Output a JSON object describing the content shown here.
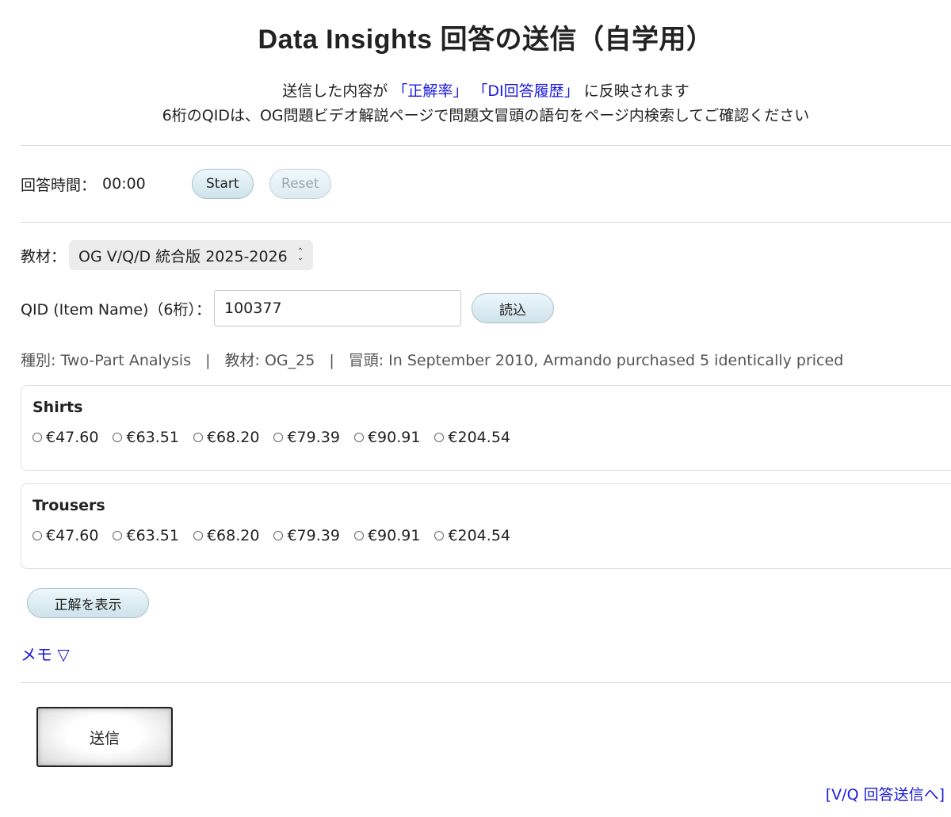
{
  "title": "Data Insights 回答の送信（自学用）",
  "notice": {
    "line1_prefix": "送信した内容が",
    "link1": "「正解率」",
    "link2": "「DI回答履歴」",
    "line1_suffix": "に反映されます",
    "line2": "6桁のQIDは、OG問題ビデオ解説ページで問題文冒頭の語句をページ内検索してご確認ください"
  },
  "timer": {
    "label": "回答時間：",
    "value": "00:00",
    "start_label": "Start",
    "reset_label": "Reset"
  },
  "material": {
    "label": "教材：",
    "selected": "OG V/Q/D 統合版 2025-2026"
  },
  "qid": {
    "label": "QID (Item Name)（6桁）：",
    "value": "100377",
    "load_label": "読込"
  },
  "meta": {
    "type": "種別: Two-Part Analysis",
    "material": "教材: OG_25",
    "opening": "冒頭: In September 2010, Armando purchased 5 identically priced",
    "separator": "|"
  },
  "columns": [
    {
      "label": "Shirts",
      "options": [
        "€47.60",
        "€63.51",
        "€68.20",
        "€79.39",
        "€90.91",
        "€204.54"
      ]
    },
    {
      "label": "Trousers",
      "options": [
        "€47.60",
        "€63.51",
        "€68.20",
        "€79.39",
        "€90.91",
        "€204.54"
      ]
    }
  ],
  "show_answer_label": "正解を表示",
  "memo_label": "メモ ▽",
  "submit_label": "送信",
  "vq_link": "[V/Q 回答送信へ]"
}
